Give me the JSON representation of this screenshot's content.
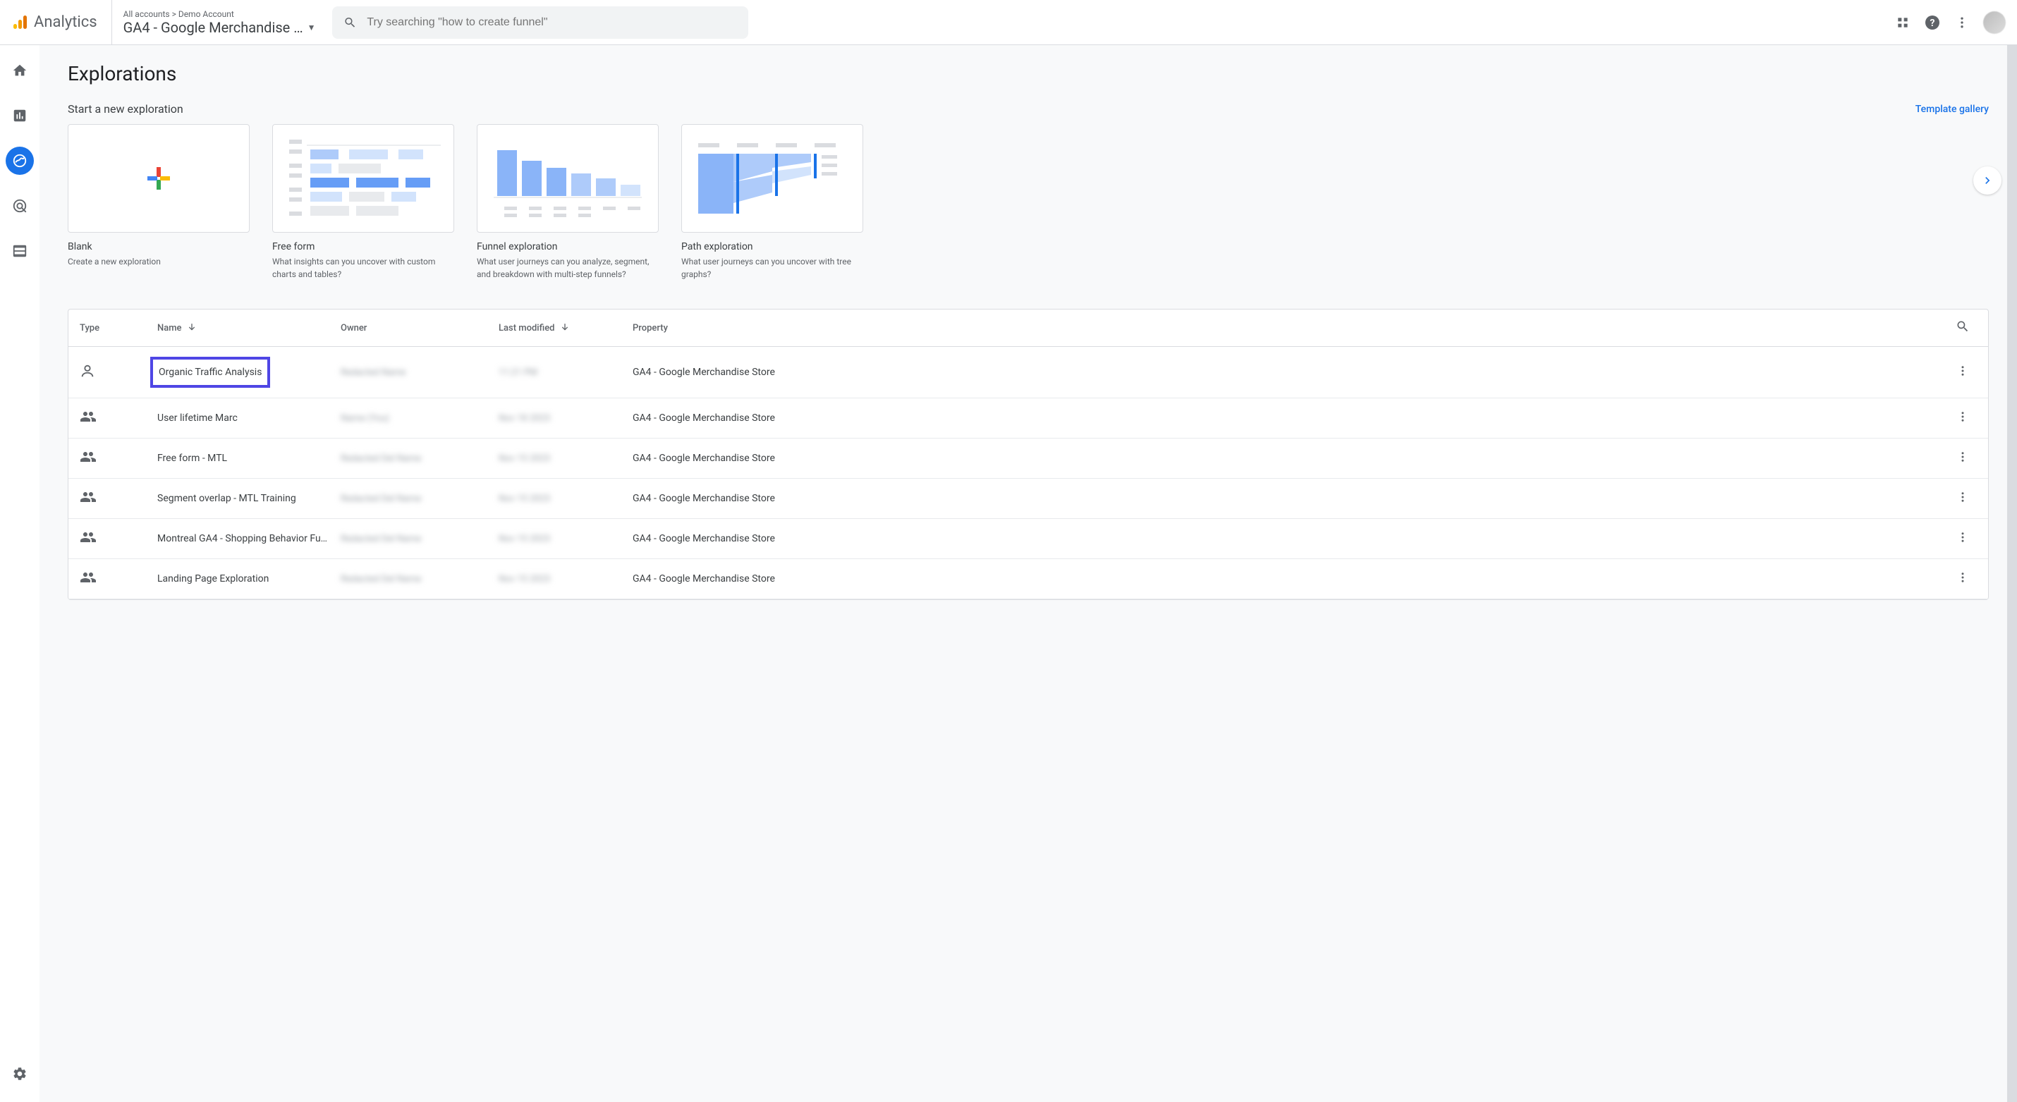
{
  "header": {
    "logo_text": "Analytics",
    "breadcrumb": "All accounts > Demo Account",
    "property": "GA4 - Google Merchandise …",
    "search_placeholder": "Try searching \"how to create funnel\""
  },
  "page": {
    "title": "Explorations",
    "subheading": "Start a new exploration",
    "template_gallery": "Template gallery"
  },
  "templates": [
    {
      "name": "Blank",
      "desc": "Create a new exploration"
    },
    {
      "name": "Free form",
      "desc": "What insights can you uncover with custom charts and tables?"
    },
    {
      "name": "Funnel exploration",
      "desc": "What user journeys can you analyze, segment, and breakdown with multi-step funnels?"
    },
    {
      "name": "Path exploration",
      "desc": "What user journeys can you uncover with tree graphs?"
    }
  ],
  "table": {
    "headers": {
      "type": "Type",
      "name": "Name",
      "owner": "Owner",
      "modified": "Last modified",
      "property": "Property"
    },
    "rows": [
      {
        "type": "person",
        "name": "Organic Traffic Analysis",
        "owner": "Redacted Name",
        "modified": "11:21 PM",
        "property": "GA4 - Google Merchandise Store",
        "highlighted": true
      },
      {
        "type": "shared",
        "name": "User lifetime Marc",
        "owner": "Name (You)",
        "modified": "Nov 18 2023",
        "property": "GA4 - Google Merchandise Store"
      },
      {
        "type": "shared",
        "name": "Free form - MTL",
        "owner": "Redacted Del Name",
        "modified": "Nov 15 2023",
        "property": "GA4 - Google Merchandise Store"
      },
      {
        "type": "shared",
        "name": "Segment overlap - MTL Training",
        "owner": "Redacted Del Name",
        "modified": "Nov 15 2023",
        "property": "GA4 - Google Merchandise Store"
      },
      {
        "type": "shared",
        "name": "Montreal GA4 - Shopping Behavior Fu…",
        "owner": "Redacted Del Name",
        "modified": "Nov 15 2023",
        "property": "GA4 - Google Merchandise Store"
      },
      {
        "type": "shared",
        "name": "Landing Page Exploration",
        "owner": "Redacted Del Name",
        "modified": "Nov 15 2023",
        "property": "GA4 - Google Merchandise Store"
      }
    ]
  }
}
